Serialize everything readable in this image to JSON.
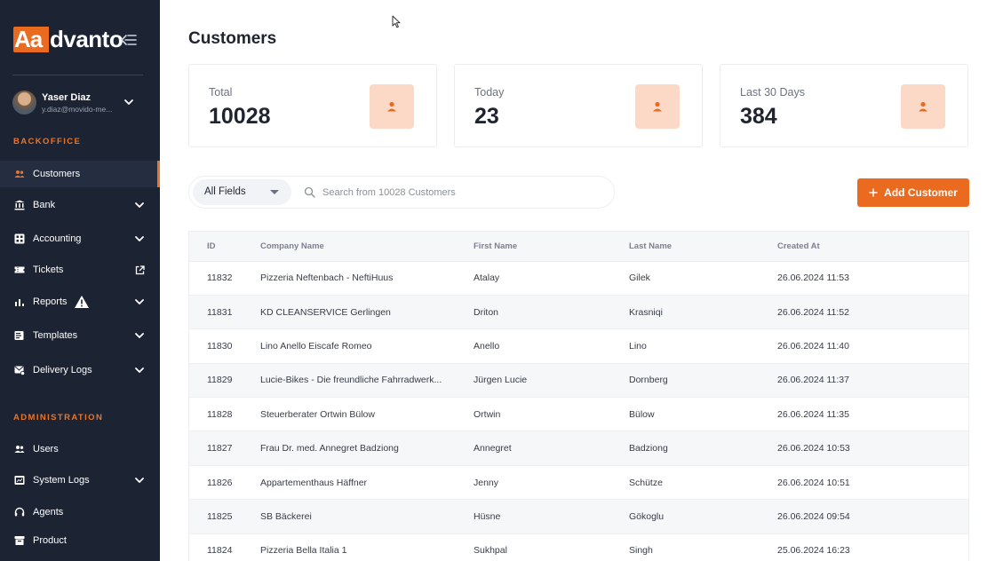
{
  "brand": {
    "logo_mark": "Aa",
    "logo_rest": "dvanto"
  },
  "user": {
    "name": "Yaser Diaz",
    "email": "y.diaz@movido-me..."
  },
  "sidebar": {
    "sections": [
      {
        "title": "BACKOFFICE"
      },
      {
        "title": "ADMINISTRATION"
      }
    ],
    "items": [
      {
        "label": "Customers",
        "icon": "users-icon"
      },
      {
        "label": "Bank",
        "icon": "bank-icon"
      },
      {
        "label": "Accounting",
        "icon": "calculator-icon"
      },
      {
        "label": "Tickets",
        "icon": "ticket-icon"
      },
      {
        "label": "Reports",
        "icon": "bar-chart-icon"
      },
      {
        "label": "Templates",
        "icon": "template-icon"
      },
      {
        "label": "Delivery Logs",
        "icon": "mail-log-icon"
      },
      {
        "label": "Users",
        "icon": "users-icon"
      },
      {
        "label": "System Logs",
        "icon": "system-log-icon"
      },
      {
        "label": "Agents",
        "icon": "headset-icon"
      },
      {
        "label": "Product",
        "icon": "box-icon"
      }
    ]
  },
  "page": {
    "title": "Customers"
  },
  "stats": [
    {
      "label": "Total",
      "value": "10028"
    },
    {
      "label": "Today",
      "value": "23"
    },
    {
      "label": "Last 30 Days",
      "value": "384"
    }
  ],
  "search": {
    "field_selected": "All Fields",
    "placeholder": "Search from 10028 Customers"
  },
  "toolbar": {
    "add_label": "Add Customer"
  },
  "colors": {
    "accent": "#ea6a1f",
    "sidebar_bg": "#1c2333",
    "stat_icon_bg": "#fbd9c6"
  },
  "table": {
    "columns": [
      "ID",
      "Company Name",
      "First Name",
      "Last Name",
      "Created At"
    ],
    "rows": [
      [
        "11832",
        "Pizzeria Neftenbach - NeftiHuus",
        "Atalay",
        "Gilek",
        "26.06.2024 11:53"
      ],
      [
        "11831",
        "KD CLEANSERVICE Gerlingen",
        "Driton",
        "Krasniqi",
        "26.06.2024 11:52"
      ],
      [
        "11830",
        "Lino Anello Eiscafe Romeo",
        "Anello",
        "Lino",
        "26.06.2024 11:40"
      ],
      [
        "11829",
        "Lucie-Bikes - Die freundliche Fahrradwerk...",
        "Jürgen Lucie",
        "Dornberg",
        "26.06.2024 11:37"
      ],
      [
        "11828",
        "Steuerberater Ortwin Bülow",
        "Ortwin",
        "Bülow",
        "26.06.2024 11:35"
      ],
      [
        "11827",
        "Frau Dr. med. Annegret Badziong",
        "Annegret",
        "Badziong",
        "26.06.2024 10:53"
      ],
      [
        "11826",
        "Appartementhaus Häffner",
        "Jenny",
        "Schütze",
        "26.06.2024 10:51"
      ],
      [
        "11825",
        "SB Bäckerei",
        "Hüsne",
        "Gökoglu",
        "26.06.2024 09:54"
      ],
      [
        "11824",
        "Pizzeria Bella Italia 1",
        "Sukhpal",
        "Singh",
        "25.06.2024 16:23"
      ]
    ]
  }
}
